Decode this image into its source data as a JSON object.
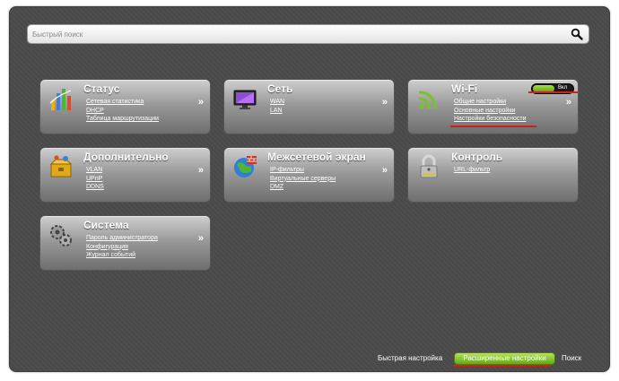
{
  "search": {
    "placeholder": "Быстрый поиск"
  },
  "tiles": {
    "status": {
      "title": "Статус",
      "links": [
        "Сетевая статистика",
        "DHCP",
        "Таблица маршрутизации"
      ]
    },
    "network": {
      "title": "Сеть",
      "links": [
        "WAN",
        "LAN"
      ]
    },
    "wifi": {
      "title": "Wi-Fi",
      "toggle_label": "Вкл",
      "links": [
        "Общие настройки",
        "Основные настройки",
        "Настройки безопасности"
      ]
    },
    "advanced": {
      "title": "Дополнительно",
      "links": [
        "VLAN",
        "UPnP",
        "DDNS"
      ]
    },
    "firewall": {
      "title": "Межсетевой экран",
      "links": [
        "IP-фильтры",
        "Виртуальные серверы",
        "DMZ"
      ]
    },
    "control": {
      "title": "Контроль",
      "links": [
        "URL-фильтр"
      ]
    },
    "system": {
      "title": "Система",
      "links": [
        "Пароль администратора",
        "Конфигурация",
        "Журнал событий"
      ]
    }
  },
  "arrow": "»",
  "bottom": {
    "quick_setup": "Быстрая настройка",
    "advanced_settings": "Расширенные настройки",
    "search": "Поиск"
  },
  "colors": {
    "panel": "#4a4a4a",
    "accent_green": "#8ccc2e",
    "highlight_red": "#d0201a"
  }
}
